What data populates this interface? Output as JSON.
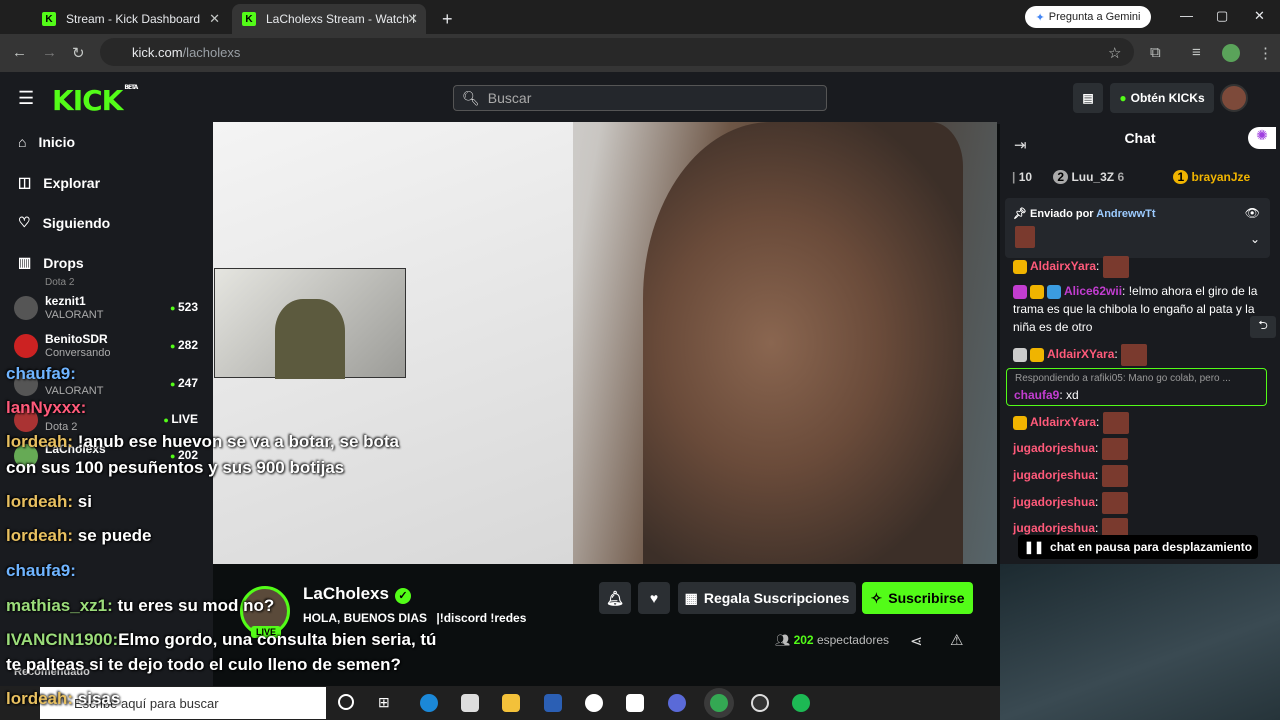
{
  "browser": {
    "tabs": [
      {
        "label": "Stream - Kick Dashboard"
      },
      {
        "label": "LaCholexs Stream - Watch l"
      }
    ],
    "gemini_label": "Pregunta a Gemini",
    "url_host": "kick.com",
    "url_path": "/lacholexs"
  },
  "header": {
    "logo": "KICK",
    "logo_tag": "BETA",
    "search_placeholder": "Buscar",
    "kicks_button": "Obtén KICKs"
  },
  "sidebar": {
    "nav": [
      {
        "label": "Inicio",
        "icon": "home-icon"
      },
      {
        "label": "Explorar",
        "icon": "compass-icon"
      },
      {
        "label": "Siguiendo",
        "icon": "heart-icon"
      },
      {
        "label": "Drops",
        "icon": "drops-icon"
      }
    ],
    "channels": [
      {
        "name": "keznit1",
        "game": "VALORANT",
        "viewers": "523"
      },
      {
        "name": "BenitoSDR",
        "game": "Conversando",
        "viewers": "282"
      },
      {
        "name": "",
        "game": "VALORANT",
        "viewers": "247"
      },
      {
        "name": "",
        "game": "Dota 2",
        "viewers": "LIVE"
      },
      {
        "name": "LaCholexs",
        "game": "",
        "viewers": "202"
      }
    ],
    "dota_top": "Dota 2",
    "recommended": "Recomendado"
  },
  "stream": {
    "name": "LaCholexs",
    "title": "HOLA, BUENOS DIAS",
    "commands": "!discord !redes",
    "live": "LIVE",
    "gift_button": "Regala Suscripciones",
    "subscribe_button": "Suscribirse",
    "viewers_count": "202",
    "viewers_label": "espectadores"
  },
  "chat": {
    "title": "Chat",
    "gifters": [
      {
        "rank": "10",
        "name": ""
      },
      {
        "rank": "2",
        "name": "Luu_3Z",
        "count": "6"
      },
      {
        "rank": "1",
        "name": "brayanJze"
      }
    ],
    "pinned_label": "Enviado por",
    "pinned_user": "AndrewwTt",
    "messages": [
      {
        "user": "AldairxYara",
        "text": "",
        "color": "#ff5a7a"
      },
      {
        "user": "Alice62wii",
        "text": "!elmo ahora el giro de la trama es que la chibola lo engaño al pata y la niña es de otro",
        "color": "#ff5a7a"
      },
      {
        "user": "AldairXYara",
        "text": "",
        "color": "#ff5a7a"
      },
      {
        "user": "AldairxYara",
        "text": "",
        "color": "#ff5a7a"
      },
      {
        "user": "jugadorjeshua",
        "text": "",
        "color": "#ff5a7a"
      },
      {
        "user": "jugadorjeshua",
        "text": "",
        "color": "#ff5a7a"
      },
      {
        "user": "jugadorjeshua",
        "text": "",
        "color": "#ff5a7a"
      },
      {
        "user": "jugadorjeshua",
        "text": "",
        "color": "#ff5a7a"
      }
    ],
    "reply_context": "Respondiendo a rafiki05: Mano go colab, pero ...",
    "reply_user": "chaufa9",
    "reply_text": "xd",
    "paused": "chat en pausa para desplazamiento"
  },
  "overlay": [
    {
      "user": "chaufa9:",
      "text": "",
      "color": "u2"
    },
    {
      "user": "lanNyxxx:",
      "text": "",
      "color": "u3"
    },
    {
      "user": "lordeah:",
      "text": "!anub ese huevon se va a botar, se bota",
      "color": "u1"
    },
    {
      "user": "",
      "text": "con sus 100 pesuñentos y sus 900 botijas",
      "color": "u1"
    },
    {
      "user": "lordeah:",
      "text": "si",
      "color": "u1"
    },
    {
      "user": "lordeah:",
      "text": "se puede",
      "color": "u1"
    },
    {
      "user": "chaufa9:",
      "text": "",
      "color": "u2"
    },
    {
      "user": "mathias_xz1:",
      "text": "tu eres su mod no?",
      "color": "u4"
    },
    {
      "user": "IVANCIN1900:",
      "text": "Elmo gordo, una consulta bien seria, tú",
      "color": "u4"
    },
    {
      "user": "",
      "text": "te palteas si te dejo todo el culo lleno de semen?",
      "color": "u4"
    },
    {
      "user": "lordeah:",
      "text": "sisas",
      "color": "u1"
    }
  ],
  "taskbar": {
    "search_placeholder": "Escribe aquí para buscar"
  }
}
